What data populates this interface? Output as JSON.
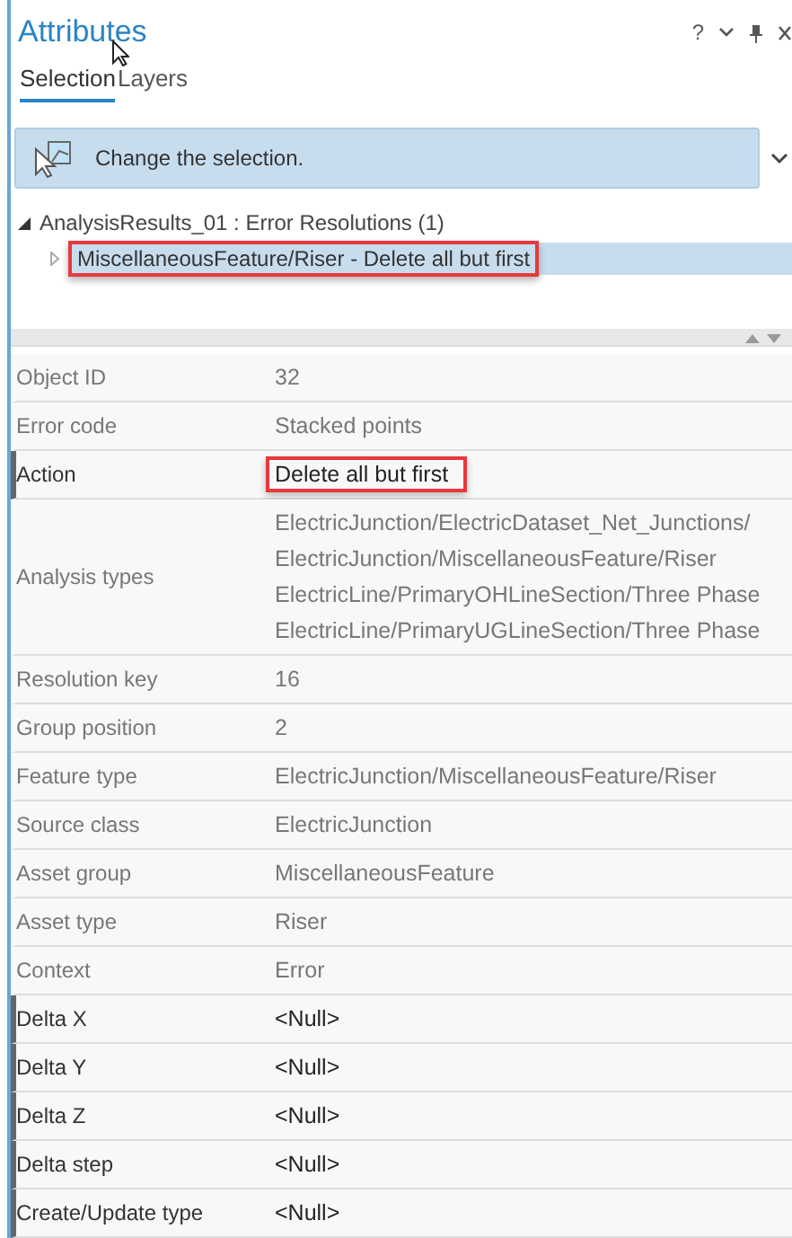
{
  "window": {
    "title": "Attributes",
    "controls": [
      "?"
    ]
  },
  "tabs": [
    {
      "label": "Selection",
      "selected": true
    },
    {
      "label": "Layers",
      "selected": false
    }
  ],
  "message": {
    "text": "Change the selection."
  },
  "tree": {
    "label": "AnalysisResults_01 : Error Resolutions (1)",
    "expanded": true,
    "children": [
      {
        "label": "MiscellaneousFeature/Riser - Delete all but first",
        "selected": true,
        "highlighted": true
      }
    ]
  },
  "attributes": [
    {
      "label": "Object ID",
      "value": [
        "32"
      ],
      "editable": false,
      "highlighted": false
    },
    {
      "label": "Error code",
      "value": [
        "Stacked points"
      ],
      "editable": false,
      "highlighted": false
    },
    {
      "label": "Action",
      "value": [
        "Delete all but first"
      ],
      "editable": true,
      "highlighted": true
    },
    {
      "label": "Analysis types",
      "value": [
        "ElectricJunction/ElectricDataset_Net_Junctions/",
        "ElectricJunction/MiscellaneousFeature/Riser",
        "ElectricLine/PrimaryOHLineSection/Three Phase",
        "ElectricLine/PrimaryUGLineSection/Three Phase"
      ],
      "editable": false,
      "highlighted": false
    },
    {
      "label": "Resolution key",
      "value": [
        "16"
      ],
      "editable": false,
      "highlighted": false
    },
    {
      "label": "Group position",
      "value": [
        "2"
      ],
      "editable": false,
      "highlighted": false
    },
    {
      "label": "Feature type",
      "value": [
        "ElectricJunction/MiscellaneousFeature/Riser"
      ],
      "editable": false,
      "highlighted": false
    },
    {
      "label": "Source class",
      "value": [
        "ElectricJunction"
      ],
      "editable": false,
      "highlighted": false
    },
    {
      "label": "Asset group",
      "value": [
        "MiscellaneousFeature"
      ],
      "editable": false,
      "highlighted": false
    },
    {
      "label": "Asset type",
      "value": [
        "Riser"
      ],
      "editable": false,
      "highlighted": false
    },
    {
      "label": "Context",
      "value": [
        "Error"
      ],
      "editable": false,
      "highlighted": false
    },
    {
      "label": "Delta X",
      "value": [
        "<Null>"
      ],
      "editable": true,
      "highlighted": false
    },
    {
      "label": "Delta Y",
      "value": [
        "<Null>"
      ],
      "editable": true,
      "highlighted": false
    },
    {
      "label": "Delta Z",
      "value": [
        "<Null>"
      ],
      "editable": true,
      "highlighted": false
    },
    {
      "label": "Delta step",
      "value": [
        "<Null>"
      ],
      "editable": true,
      "highlighted": false
    },
    {
      "label": "Create/Update type",
      "value": [
        "<Null>"
      ],
      "editable": true,
      "highlighted": false
    }
  ]
}
